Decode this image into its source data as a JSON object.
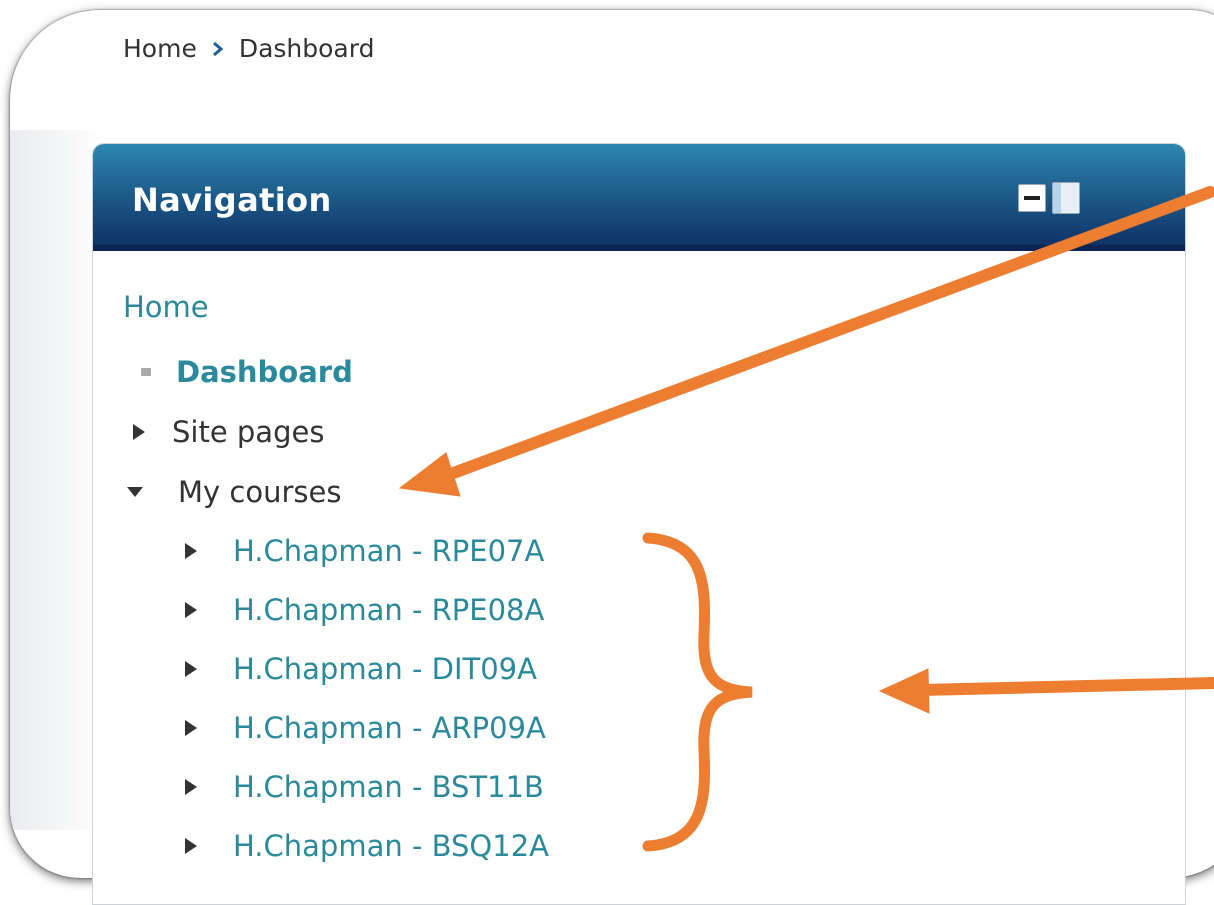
{
  "breadcrumb": {
    "home": "Home",
    "current": "Dashboard"
  },
  "nav_block": {
    "title": "Navigation",
    "home": "Home",
    "dashboard": "Dashboard",
    "site_pages": "Site pages",
    "my_courses": "My courses",
    "courses": [
      "H.Chapman - RPE07A",
      "H.Chapman - RPE08A",
      "H.Chapman - DIT09A",
      "H.Chapman - ARP09A",
      "H.Chapman - BST11B",
      "H.Chapman - BSQ12A"
    ]
  },
  "annotation_color": "#ED7D31"
}
